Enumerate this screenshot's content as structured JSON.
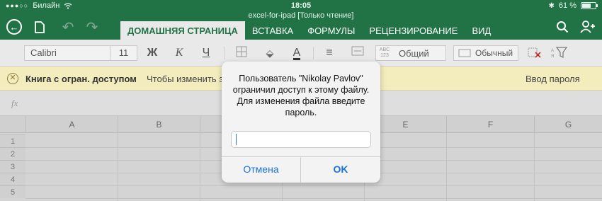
{
  "status_bar": {
    "carrier": "Билайн",
    "time": "18:05",
    "battery": "61 %"
  },
  "document_title": "excel-for-ipad [Только чтение]",
  "ribbon_tabs": [
    {
      "label": "ДОМАШНЯЯ СТРАНИЦА",
      "active": true
    },
    {
      "label": "ВСТАВКА",
      "active": false
    },
    {
      "label": "ФОРМУЛЫ",
      "active": false
    },
    {
      "label": "РЕЦЕНЗИРОВАНИЕ",
      "active": false
    },
    {
      "label": "ВИД",
      "active": false
    }
  ],
  "toolbar": {
    "font_name": "Calibri",
    "font_size": "11",
    "bold": "Ж",
    "italic": "К",
    "underline": "Ч",
    "number_format_abc": "ABC 123",
    "number_format": "Общий",
    "cell_style": "Обычный"
  },
  "info_bar": {
    "title": "Книга с огран. доступом",
    "message": "Чтобы изменить э",
    "action": "Ввод пароля"
  },
  "formula_bar": {
    "fx_label": "fx"
  },
  "grid": {
    "columns": [
      "A",
      "B",
      "C",
      "D",
      "E",
      "F",
      "G"
    ],
    "rows": [
      "1",
      "2",
      "3",
      "4",
      "5"
    ]
  },
  "dialog": {
    "message": "Пользователь \"Nikolay Pavlov\" ограничил доступ к этому файлу. Для изменения файла введите пароль.",
    "password_value": "",
    "cancel_label": "Отмена",
    "ok_label": "OK"
  },
  "colors": {
    "excel_green": "#217346",
    "ios_blue": "#1a72d9",
    "infobar_yellow": "#f3edbd"
  }
}
